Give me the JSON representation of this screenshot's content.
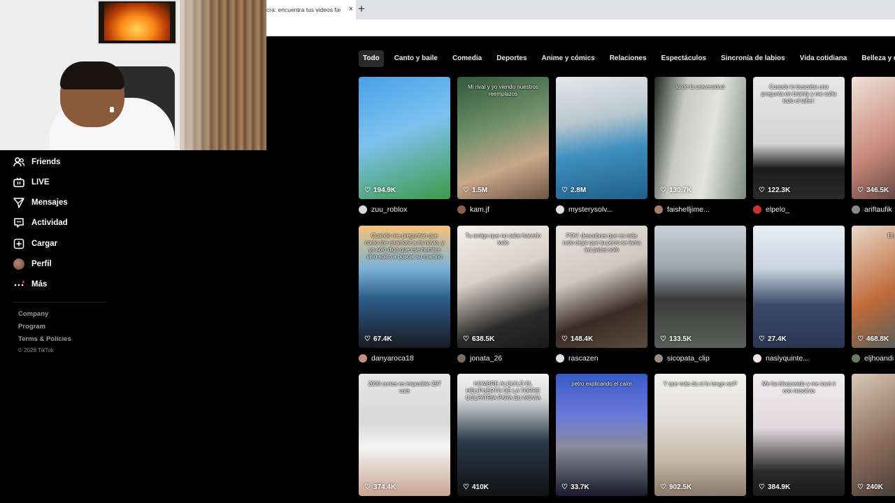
{
  "browser": {
    "tab_title": "cra: encuentra tus videos favo",
    "tab_close": "×",
    "new_tab": "+"
  },
  "sidebar": {
    "items": [
      {
        "label": "Friends",
        "icon": "friends-icon"
      },
      {
        "label": "LIVE",
        "icon": "live-icon"
      },
      {
        "label": "Mensajes",
        "icon": "messages-icon"
      },
      {
        "label": "Actividad",
        "icon": "activity-icon"
      },
      {
        "label": "Cargar",
        "icon": "upload-icon"
      },
      {
        "label": "Perfil",
        "icon": "avatar"
      },
      {
        "label": "Más",
        "icon": "more-icon"
      }
    ],
    "footer": {
      "company": "Company",
      "program": "Program",
      "terms": "Terms & Policies",
      "copyright": "© 2026 TikTok"
    }
  },
  "chips": [
    "Todo",
    "Canto y baile",
    "Comedia",
    "Deportes",
    "Anime y cómics",
    "Relaciones",
    "Espectáculos",
    "Sincronía de labios",
    "Vida cotidiana",
    "Belleza y cuidado personal"
  ],
  "active_chip": "Todo",
  "videos": [
    [
      {
        "likes": "194.9K",
        "author": "zuu_roblox",
        "caption": "",
        "bg": "linear-gradient(160deg,#4aa0e8 0%,#7cc3f0 45%,#3d9a46 100%)",
        "av": "#d9d9d9"
      },
      {
        "likes": "1.5M",
        "author": "kam.jf",
        "caption": "Mi rival y yo viendo nuestros reemplazos",
        "bg": "linear-gradient(160deg,#2f5a3a 0%,#6f8f6a 40%,#c9a788 70%,#6d5545 100%)",
        "av": "#8b5e4b"
      },
      {
        "likes": "2.8M",
        "author": "mysterysolv...",
        "caption": "",
        "bg": "linear-gradient(170deg,#e6e8ea 0%,#b9c7cf 35%,#3f8fbf 60%,#1f5f8a 100%)",
        "av": "#e0e0e0"
      },
      {
        "likes": "130.7K",
        "author": "faishelljime...",
        "caption": "lo de la universidad",
        "bg": "linear-gradient(100deg,#1d2a22 0%,#c9c9c4 30%,#e4e4df 60%,#7a8a7e 100%)",
        "av": "#b07a6a"
      },
      {
        "likes": "122.3K",
        "author": "elpelo_",
        "caption": "Cuando le buscaba una pregunta en brainly y me salía todo el taller:",
        "bg": "linear-gradient(180deg,#e8e8e8 0%,#d4d4d4 55%,#1c1c1c 75%,#2a2a2a 100%)",
        "av": "#d0312d"
      },
      {
        "likes": "346.5K",
        "author": "ariftaufik",
        "caption": "",
        "bg": "linear-gradient(150deg,#f0e0d8 0%,#c98a7a 50%,#3a2a2a 100%)",
        "av": "#888"
      }
    ],
    [
      {
        "likes": "67.4K",
        "author": "danyaroca18",
        "caption": "Cuando me preguntan que como me enamoré a mi novio, y yo solo digo que ese hombre vino solito a buscar su martirio",
        "bg": "linear-gradient(180deg,#f7c27a 0%,#7ab3d6 35%,#2c5c8a 60%,#1a1a22 100%)",
        "av": "#c48f80"
      },
      {
        "likes": "638.5K",
        "author": "jonata_26",
        "caption": "Tu amigo que no sabe hacerlo todo",
        "bg": "linear-gradient(160deg,#f4f1ec 0%,#d8d2c8 40%,#2a2a2a 75%,#1a1a1a 100%)",
        "av": "#7a6a60"
      },
      {
        "likes": "148.4K",
        "author": "rascazen",
        "caption": "POV: descubres que es más rudo dejar que tu perro se lama las patas solo",
        "bg": "linear-gradient(160deg,#e8e4df 0%,#cfc8bf 40%,#3a2c25 70%,#5a4a40 100%)",
        "av": "#e0e0e0"
      },
      {
        "likes": "133.5K",
        "author": "sicopata_clip",
        "caption": "",
        "bg": "linear-gradient(180deg,#c8d0d8 0%,#9aa5ae 35%,#3a3a3a 60%,#5a5f5a 100%)",
        "av": "#9a8a80"
      },
      {
        "likes": "27.4K",
        "author": "naslyquinte...",
        "caption": "",
        "bg": "linear-gradient(180deg,#e8eef5 0%,#c9d4e0 35%,#3a4a6a 65%,#2a3552 100%)",
        "av": "#f0e0e8"
      },
      {
        "likes": "468.8K",
        "author": "eljhoandi",
        "caption": "El perro",
        "bg": "linear-gradient(150deg,#e8d8c8 0%,#c06a3a 50%,#2a5a6a 100%)",
        "av": "#6a7a60"
      }
    ],
    [
      {
        "likes": "374.4K",
        "author": "",
        "caption": "2000 cortes es imposible 297 cuts",
        "bg": "linear-gradient(180deg,#e6e6e6 0%,#d8d8d8 40%,#f5f5f5 60%,#c9a592 100%)",
        "av": "#888"
      },
      {
        "likes": "410K",
        "author": "",
        "caption": "HOMBRE ALQUILÓ EL HELIPUERTO DE LA TORRE COLPATRIA PARA SU NOVIA",
        "bg": "linear-gradient(180deg,#f2f2f2 0%,#dcdcdc 20%,#2a3a4a 55%,#111 100%)",
        "av": "#888"
      },
      {
        "likes": "33.7K",
        "author": "",
        "caption": "petro explicando el calor",
        "bg": "linear-gradient(180deg,#3a5ac8 0%,#6a7ad8 35%,#8a8a9a 60%,#1a1a2a 100%)",
        "av": "#888"
      },
      {
        "likes": "902.5K",
        "author": "",
        "caption": "Y que más da si la tengo así?",
        "bg": "linear-gradient(180deg,#f2f2ee 0%,#e0ddd6 40%,#c9b9a8 70%,#8a7a6a 100%)",
        "av": "#888"
      },
      {
        "likes": "384.9K",
        "author": "",
        "caption": "Me ha bloqueado y me tocó ir con nosotras",
        "bg": "linear-gradient(180deg,#f0eef0 0%,#e0d8dc 45%,#2a2a2a 80%,#1a1a1a 100%)",
        "av": "#888"
      },
      {
        "likes": "240K",
        "author": "",
        "caption": "",
        "bg": "linear-gradient(150deg,#d8c8b8 0%,#8a6a5a 50%,#2a2a2a 100%)",
        "av": "#888"
      }
    ]
  ],
  "colors": {
    "page_bg": "#000000",
    "text_primary": "#ffffff",
    "text_muted": "#9a9a9a",
    "chip_active_bg": "#2a2a2a"
  }
}
